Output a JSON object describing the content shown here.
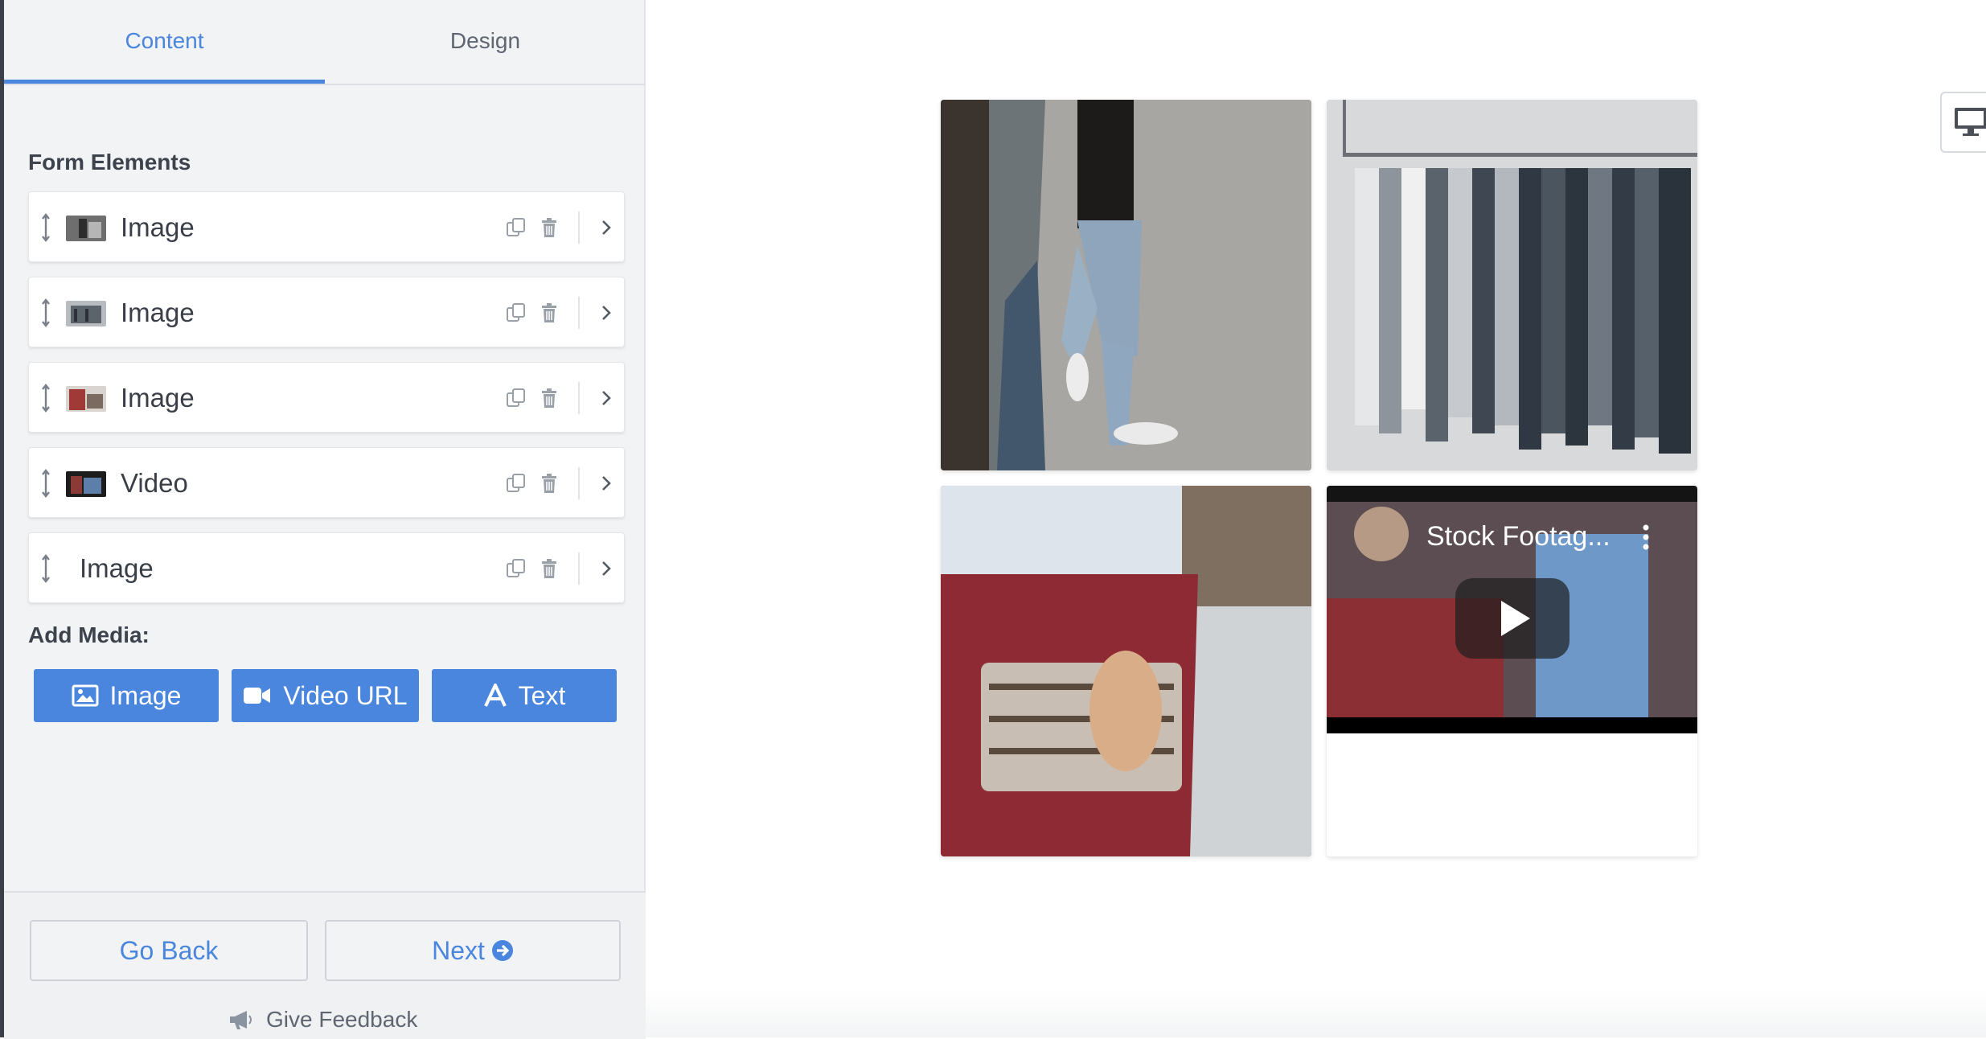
{
  "tabs": [
    {
      "label": "Content",
      "active": true
    },
    {
      "label": "Design",
      "active": false
    }
  ],
  "form_elements": {
    "title": "Form Elements",
    "items": [
      {
        "label": "Image",
        "thumb": "#8a8a8a"
      },
      {
        "label": "Image",
        "thumb": "#7e858c"
      },
      {
        "label": "Image",
        "thumb": "#a4463f"
      },
      {
        "label": "Video",
        "thumb": "#5a2e2a"
      },
      {
        "label": "Image",
        "thumb": ""
      }
    ]
  },
  "add_media": {
    "title": "Add Media:",
    "buttons": [
      {
        "label": "Image",
        "icon": "image-icon"
      },
      {
        "label": "Video URL",
        "icon": "video-camera-icon"
      },
      {
        "label": "Text",
        "icon": "text-a-icon"
      }
    ]
  },
  "footer": {
    "back_label": "Go Back",
    "next_label": "Next",
    "feedback_label": "Give Feedback"
  },
  "preview": {
    "video_title": "Stock Footag..."
  },
  "colors": {
    "accent": "#4a86dd",
    "sidebar_bg": "#f2f3f5"
  }
}
